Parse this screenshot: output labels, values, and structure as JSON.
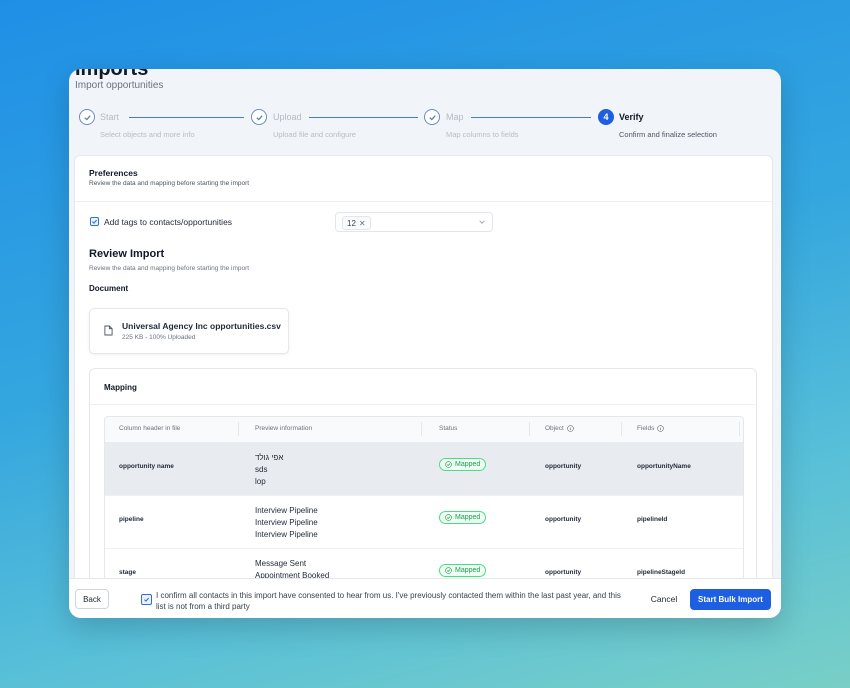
{
  "header": {
    "title": "Imports",
    "subtitle": "Import opportunities"
  },
  "steps": [
    {
      "label": "Start",
      "description": "Select objects and more info",
      "state": "done"
    },
    {
      "label": "Upload",
      "description": "Upload file and configure",
      "state": "done"
    },
    {
      "label": "Map",
      "description": "Map columns to fields",
      "state": "done"
    },
    {
      "label": "Verify",
      "description": "Confirm and finalize selection",
      "state": "active",
      "number": "4"
    }
  ],
  "preferences": {
    "title": "Preferences",
    "subtitle": "Review the data and mapping before starting the import",
    "add_tags_label": "Add tags to contacts/opportunities",
    "add_tags_checked": true,
    "tag_chip": "12"
  },
  "review": {
    "title": "Review Import",
    "subtitle": "Review the data and mapping before starting the import",
    "document_label": "Document",
    "file_name": "Universal Agency Inc opportunities.csv",
    "file_meta": "225 KB - 100% Uploaded"
  },
  "mapping": {
    "title": "Mapping",
    "columns": {
      "header": "Column header in file",
      "preview": "Preview information",
      "status": "Status",
      "object": "Object",
      "fields": "Fields"
    },
    "rows": [
      {
        "name": "opportunity name",
        "preview": [
          "אפי גולד",
          "sds",
          "lop"
        ],
        "status": "Mapped",
        "object": "opportunity",
        "field": "opportunityName"
      },
      {
        "name": "pipeline",
        "preview": [
          "Interview Pipeline",
          "Interview Pipeline",
          "Interview Pipeline"
        ],
        "status": "Mapped",
        "object": "opportunity",
        "field": "pipelineId"
      },
      {
        "name": "stage",
        "preview": [
          "Message Sent",
          "Appointment Booked",
          ""
        ],
        "status": "Mapped",
        "object": "opportunity",
        "field": "pipelineStageId"
      }
    ]
  },
  "footer": {
    "back": "Back",
    "consent": "I confirm all contacts in this import have consented to hear from us. I've previously contacted them within the last past year, and this list is not from a third party",
    "consent_checked": true,
    "cancel": "Cancel",
    "primary": "Start Bulk Import"
  },
  "colors": {
    "accent": "#1d5fe0",
    "mapped": "#16a34a"
  }
}
